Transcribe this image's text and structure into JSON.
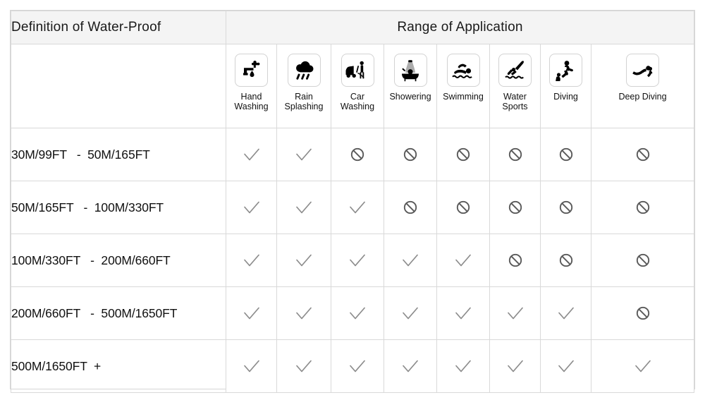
{
  "banner": {
    "definition_title": "Definition of Water-Proof",
    "range_title": "Range of Application"
  },
  "columns": [
    {
      "label": "Hand\nWashing",
      "icon": "faucet-icon"
    },
    {
      "label": "Rain\nSplashing",
      "icon": "rain-cloud-icon"
    },
    {
      "label": "Car\nWashing",
      "icon": "car-washing-icon"
    },
    {
      "label": "Showering",
      "icon": "showering-icon"
    },
    {
      "label": "Swimming",
      "icon": "swimming-icon"
    },
    {
      "label": "Water\nSports",
      "icon": "water-sports-icon"
    },
    {
      "label": "Diving",
      "icon": "diving-icon"
    },
    {
      "label": "Deep Diving",
      "icon": "deep-diving-icon"
    }
  ],
  "rows": [
    {
      "label": "30M/99FT   -  50M/165FT",
      "marks": [
        "check",
        "check",
        "no",
        "no",
        "no",
        "no",
        "no",
        "no"
      ]
    },
    {
      "label": "50M/165FT   -  100M/330FT",
      "marks": [
        "check",
        "check",
        "check",
        "no",
        "no",
        "no",
        "no",
        "no"
      ]
    },
    {
      "label": "100M/330FT   -  200M/660FT",
      "marks": [
        "check",
        "check",
        "check",
        "check",
        "check",
        "no",
        "no",
        "no"
      ]
    },
    {
      "label": "200M/660FT   -  500M/1650FT",
      "marks": [
        "check",
        "check",
        "check",
        "check",
        "check",
        "check",
        "check",
        "no"
      ]
    },
    {
      "label": "500M/1650FT  +",
      "marks": [
        "check",
        "check",
        "check",
        "check",
        "check",
        "check",
        "check",
        "check"
      ]
    }
  ],
  "symbols": {
    "check_name": "check-mark-icon",
    "no_name": "prohibited-icon",
    "check_color": "#8c8c8c",
    "no_color": "#5a5a5a"
  },
  "colors": {
    "banner_bg": "#f4f4f4",
    "border": "#d9d9d9",
    "text": "#111111",
    "page_bg": "#ffffff"
  }
}
